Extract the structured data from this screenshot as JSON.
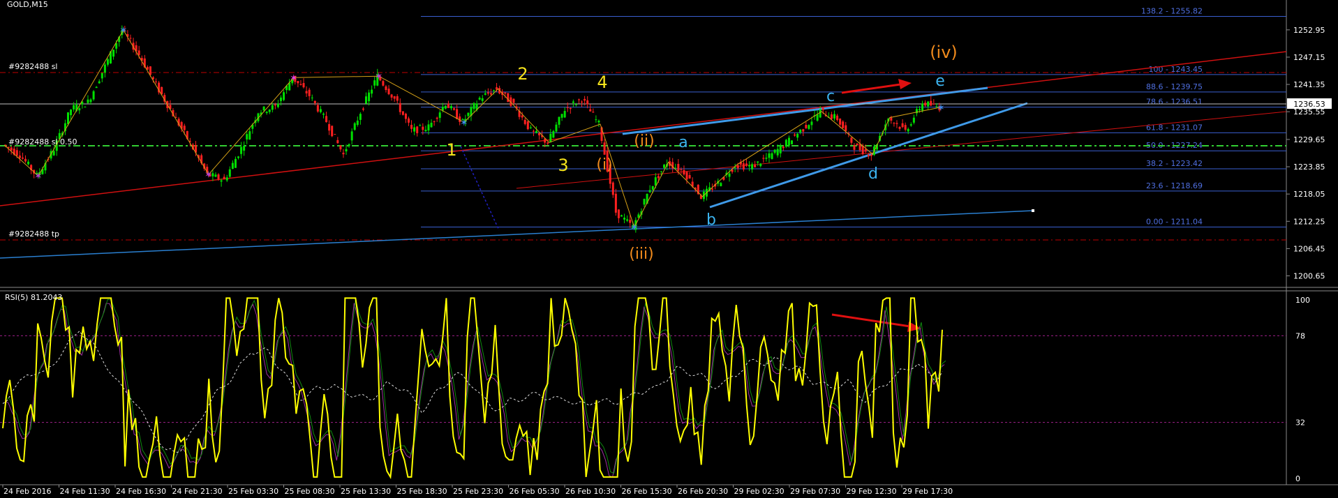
{
  "header": {
    "symbol": "GOLD,M15"
  },
  "orders": {
    "sl_label": "#9282488 sl",
    "slsl_label": "#9282488 sl 0.50",
    "tp_label": "#9282488 tp"
  },
  "price_axis": {
    "ticks": [
      "1252.95",
      "1247.15",
      "1241.35",
      "1235.55",
      "1229.65",
      "1223.85",
      "1218.05",
      "1212.25",
      "1206.45",
      "1200.65"
    ],
    "current_price": "1236.53",
    "ylim": [
      1198.5,
      1259.3
    ]
  },
  "fib": [
    {
      "label": "138.2 - 1255.82",
      "price": 1255.82
    },
    {
      "label": "100 - 1243.45",
      "price": 1243.45
    },
    {
      "label": "88.6 - 1239.75",
      "price": 1239.75
    },
    {
      "label": "78.6 - 1236.51",
      "price": 1236.51
    },
    {
      "label": "61.8 - 1231.07",
      "price": 1231.07
    },
    {
      "label": "50.0 - 1227.24",
      "price": 1227.24
    },
    {
      "label": "38.2 - 1223.42",
      "price": 1223.42
    },
    {
      "label": "23.6 - 1218.69",
      "price": 1218.69
    },
    {
      "label": "0.00 - 1211.04",
      "price": 1211.04
    }
  ],
  "wave_labels": {
    "w1": "1",
    "w2": "2",
    "w3": "3",
    "w4": "4",
    "wi": "(i)",
    "wii": "(ii)",
    "wiii": "(iii)",
    "wiv": "(iv)",
    "a": "a",
    "b": "b",
    "c": "c",
    "d": "d",
    "e": "e"
  },
  "rsi": {
    "title": "RSI(5) 81.2043",
    "ticks": [
      "100",
      "78",
      "32",
      "0"
    ],
    "levels": [
      100,
      78,
      32,
      0
    ],
    "current": 81.2043
  },
  "time_axis": [
    "24 Feb 2016",
    "24 Feb 11:30",
    "24 Feb 16:30",
    "24 Feb 21:30",
    "25 Feb 03:30",
    "25 Feb 08:30",
    "25 Feb 13:30",
    "25 Feb 18:30",
    "25 Feb 23:30",
    "26 Feb 05:30",
    "26 Feb 10:30",
    "26 Feb 15:30",
    "26 Feb 20:30",
    "29 Feb 02:30",
    "29 Feb 07:30",
    "29 Feb 12:30",
    "29 Feb 17:30"
  ],
  "chart_data": {
    "type": "line",
    "title": "GOLD,M15",
    "ylim": [
      1198.5,
      1259.3
    ],
    "grid": false,
    "series": [
      {
        "values": [
          1228.5,
          1226.4,
          1221.9,
          1227.6,
          1236.1,
          1237.6,
          1245.2,
          1252.9,
          1247.7,
          1241.2,
          1235.0,
          1228.9,
          1222.2,
          1221.0,
          1227.8,
          1235.6,
          1236.6,
          1242.8,
          1239.0,
          1233.5,
          1226.4,
          1235.5,
          1243.1,
          1238.3,
          1231.5,
          1232.3,
          1237.4,
          1233.3,
          1238.4,
          1240.4,
          1237.0,
          1231.5,
          1229.0,
          1236.1,
          1238.3,
          1232.9,
          1214.2,
          1211.0,
          1219.3,
          1224.8,
          1222.8,
          1217.5,
          1220.4,
          1224.2,
          1223.9,
          1226.0,
          1228.9,
          1232.0,
          1235.6,
          1234.1,
          1228.2,
          1226.5,
          1234.3,
          1231.5,
          1237.4,
          1236.5
        ]
      }
    ]
  }
}
